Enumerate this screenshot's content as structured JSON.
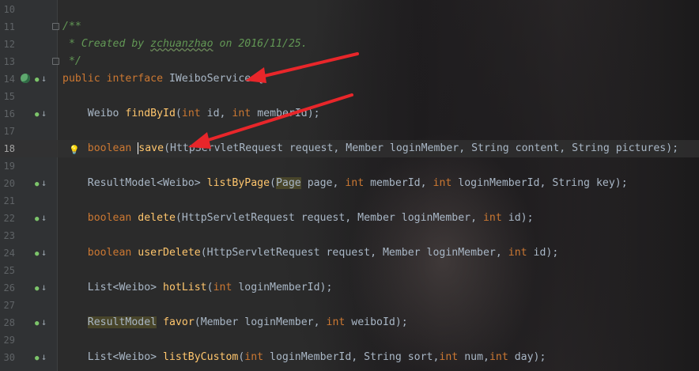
{
  "editor": {
    "lines": [
      {
        "num": "10",
        "segments": []
      },
      {
        "num": "11",
        "segments": [
          {
            "t": "/**",
            "c": "cm"
          }
        ]
      },
      {
        "num": "12",
        "segments": [
          {
            "t": " * Created by ",
            "c": "cm"
          },
          {
            "t": "zchuanzhao",
            "c": "cm-u"
          },
          {
            "t": " on 2016/11/25.",
            "c": "cm"
          }
        ]
      },
      {
        "num": "13",
        "segments": [
          {
            "t": " */",
            "c": "cm"
          }
        ]
      },
      {
        "num": "14",
        "segments": [
          {
            "t": "public interface ",
            "c": "kw"
          },
          {
            "t": "IWeiboService {",
            "c": "tx"
          }
        ]
      },
      {
        "num": "15",
        "segments": []
      },
      {
        "num": "16",
        "segments": [
          {
            "t": "    Weibo ",
            "c": "tx"
          },
          {
            "t": "findById",
            "c": "fn"
          },
          {
            "t": "(",
            "c": "tx"
          },
          {
            "t": "int",
            "c": "kw"
          },
          {
            "t": " id, ",
            "c": "tx"
          },
          {
            "t": "int",
            "c": "kw"
          },
          {
            "t": " memberId);",
            "c": "tx"
          }
        ]
      },
      {
        "num": "17",
        "segments": []
      },
      {
        "num": "18",
        "segments": [
          {
            "t": "    ",
            "c": "tx"
          },
          {
            "t": "boolean",
            "c": "kw"
          },
          {
            "t": " ",
            "c": "tx"
          },
          {
            "t": "save",
            "c": "fn caret"
          },
          {
            "t": "(HttpServletRequest request, Member loginMember, String content, String pictures);",
            "c": "tx"
          }
        ]
      },
      {
        "num": "19",
        "segments": []
      },
      {
        "num": "20",
        "segments": [
          {
            "t": "    ResultModel<Weibo> ",
            "c": "tx"
          },
          {
            "t": "listByPage",
            "c": "fn"
          },
          {
            "t": "(",
            "c": "tx"
          },
          {
            "t": "Page",
            "c": "tx hl-yellow"
          },
          {
            "t": " page, ",
            "c": "tx"
          },
          {
            "t": "int",
            "c": "kw"
          },
          {
            "t": " memberId, ",
            "c": "tx"
          },
          {
            "t": "int",
            "c": "kw"
          },
          {
            "t": " loginMemberId, String key);",
            "c": "tx"
          }
        ]
      },
      {
        "num": "21",
        "segments": []
      },
      {
        "num": "22",
        "segments": [
          {
            "t": "    ",
            "c": "tx"
          },
          {
            "t": "boolean",
            "c": "kw"
          },
          {
            "t": " ",
            "c": "tx"
          },
          {
            "t": "delete",
            "c": "fn"
          },
          {
            "t": "(HttpServletRequest request, Member loginMember, ",
            "c": "tx"
          },
          {
            "t": "int",
            "c": "kw"
          },
          {
            "t": " id);",
            "c": "tx"
          }
        ]
      },
      {
        "num": "23",
        "segments": []
      },
      {
        "num": "24",
        "segments": [
          {
            "t": "    ",
            "c": "tx"
          },
          {
            "t": "boolean",
            "c": "kw"
          },
          {
            "t": " ",
            "c": "tx"
          },
          {
            "t": "userDelete",
            "c": "fn"
          },
          {
            "t": "(HttpServletRequest request, Member loginMember, ",
            "c": "tx"
          },
          {
            "t": "int",
            "c": "kw"
          },
          {
            "t": " id);",
            "c": "tx"
          }
        ]
      },
      {
        "num": "25",
        "segments": []
      },
      {
        "num": "26",
        "segments": [
          {
            "t": "    List<Weibo> ",
            "c": "tx"
          },
          {
            "t": "hotList",
            "c": "fn"
          },
          {
            "t": "(",
            "c": "tx"
          },
          {
            "t": "int",
            "c": "kw"
          },
          {
            "t": " loginMemberId);",
            "c": "tx"
          }
        ]
      },
      {
        "num": "27",
        "segments": []
      },
      {
        "num": "28",
        "segments": [
          {
            "t": "    ",
            "c": "tx"
          },
          {
            "t": "ResultModel",
            "c": "tx hl-yellow"
          },
          {
            "t": " ",
            "c": "tx"
          },
          {
            "t": "favor",
            "c": "fn"
          },
          {
            "t": "(Member loginMember, ",
            "c": "tx"
          },
          {
            "t": "int",
            "c": "kw"
          },
          {
            "t": " weiboId);",
            "c": "tx"
          }
        ]
      },
      {
        "num": "29",
        "segments": []
      },
      {
        "num": "30",
        "segments": [
          {
            "t": "    List<Weibo> ",
            "c": "tx"
          },
          {
            "t": "listByCustom",
            "c": "fn"
          },
          {
            "t": "(",
            "c": "tx"
          },
          {
            "t": "int",
            "c": "kw"
          },
          {
            "t": " loginMemberId, String sort,",
            "c": "tx"
          },
          {
            "t": "int",
            "c": "kw"
          },
          {
            "t": " num,",
            "c": "tx"
          },
          {
            "t": "int",
            "c": "kw"
          },
          {
            "t": " day);",
            "c": "tx"
          }
        ]
      }
    ],
    "current_line": "18",
    "implemented_lines": [
      "14",
      "16",
      "20",
      "22",
      "24",
      "26",
      "28",
      "30"
    ],
    "bean_lines": [
      "14"
    ],
    "fold_lines": [
      "11",
      "13"
    ],
    "bulb_lines": [
      "18"
    ],
    "icons": {
      "implemented": "implemented-down-arrow-icon",
      "bean": "spring-bean-icon",
      "fold": "fold-marker-icon",
      "bulb": "intention-bulb-icon"
    },
    "colors": {
      "keyword": "#cc7832",
      "method": "#ffc66d",
      "comment": "#629755",
      "text": "#a9b7c6",
      "annotation_arrow": "#e8262a"
    }
  }
}
